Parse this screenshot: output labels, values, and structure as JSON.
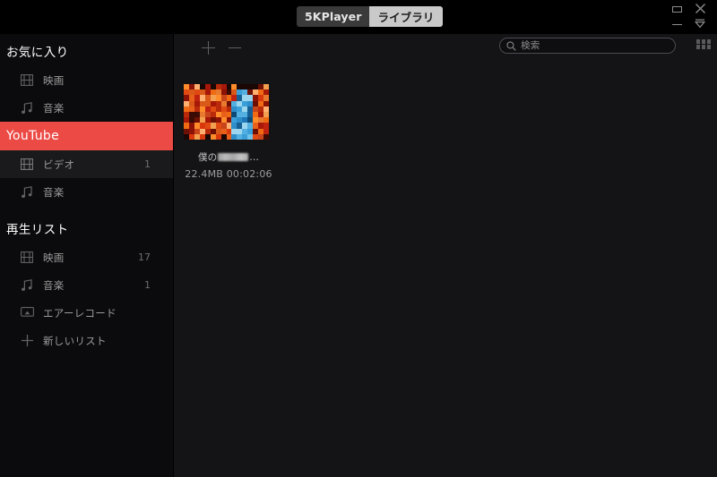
{
  "window": {
    "controls": [
      {
        "name": "maximize-button",
        "icon": "square-icon",
        "label": ""
      },
      {
        "name": "close-button",
        "icon": "close-icon",
        "label": ""
      },
      {
        "name": "minimize-button",
        "icon": "minus-icon",
        "label": ""
      },
      {
        "name": "download-button",
        "icon": "download-icon",
        "label": ""
      }
    ]
  },
  "tabs": [
    {
      "label": "5KPlayer",
      "active": false
    },
    {
      "label": "ライブラリ",
      "active": true
    }
  ],
  "sidebar": {
    "favorites": {
      "title": "お気に入り",
      "items": [
        {
          "label": "映画",
          "icon": "film-icon",
          "count": ""
        },
        {
          "label": "音楽",
          "icon": "music-note-icon",
          "count": ""
        }
      ]
    },
    "youtube": {
      "title": "YouTube",
      "accent_color": "#ec4a45",
      "items": [
        {
          "label": "ビデオ",
          "icon": "film-icon",
          "count": "1",
          "selected": true
        },
        {
          "label": "音楽",
          "icon": "music-note-icon",
          "count": "",
          "selected": false
        }
      ]
    },
    "playlist": {
      "title": "再生リスト",
      "items": [
        {
          "label": "映画",
          "icon": "film-icon",
          "count": "17"
        },
        {
          "label": "音楽",
          "icon": "music-note-icon",
          "count": "1"
        },
        {
          "label": "エアーレコード",
          "icon": "airplay-icon",
          "count": ""
        },
        {
          "label": "新しいリスト",
          "icon": "plus-icon",
          "count": ""
        }
      ]
    }
  },
  "toolbar": {
    "add_label": "+",
    "remove_label": "−",
    "search": {
      "placeholder": "検索",
      "value": "",
      "icon": "search-icon"
    },
    "grid_view": {
      "icon": "grid-view-icon"
    }
  },
  "media": {
    "items": [
      {
        "title_prefix": "僕の",
        "title_suffix": "…",
        "title_redacted": true,
        "meta": "22.4MB 00:02:06",
        "thumbnail": "mosaic-orange-blue"
      }
    ]
  }
}
